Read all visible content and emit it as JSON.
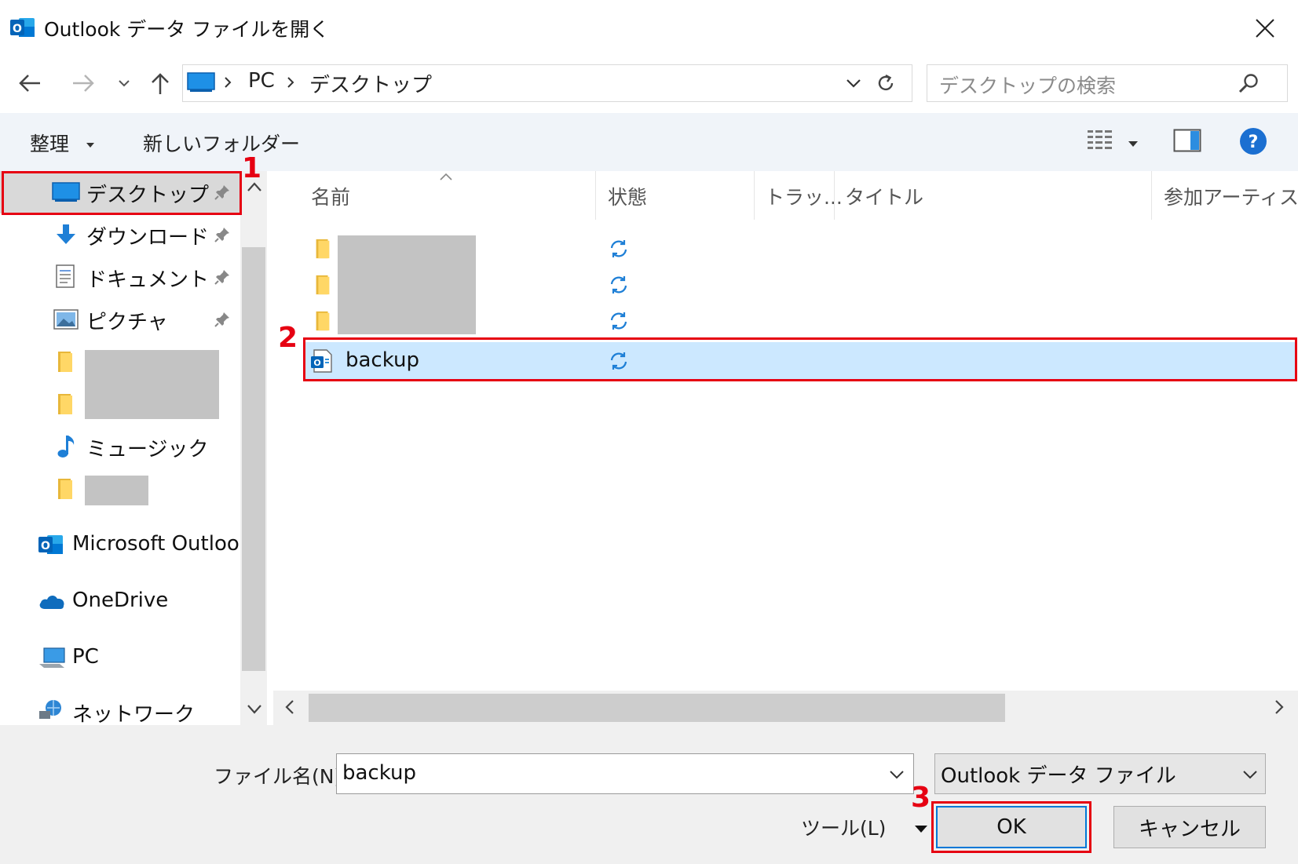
{
  "window": {
    "title": "Outlook データ ファイルを開く"
  },
  "nav": {
    "breadcrumbs": [
      "PC",
      "デスクトップ"
    ],
    "search_placeholder": "デスクトップの検索"
  },
  "toolbar": {
    "organize_label": "整理",
    "new_folder_label": "新しいフォルダー"
  },
  "sidebar": {
    "quick_access": [
      {
        "label": "デスクトップ",
        "icon": "desktop-icon",
        "pinned": true,
        "selected": true
      },
      {
        "label": "ダウンロード",
        "icon": "download-icon",
        "pinned": true
      },
      {
        "label": "ドキュメント",
        "icon": "document-icon",
        "pinned": true
      },
      {
        "label": "ピクチャ",
        "icon": "pictures-icon",
        "pinned": true
      },
      {
        "label": "",
        "icon": "folder-icon",
        "redacted": true
      },
      {
        "label": "",
        "icon": "folder-icon",
        "redacted": true
      },
      {
        "label": "ミュージック",
        "icon": "music-icon"
      },
      {
        "label": "",
        "icon": "folder-icon",
        "redacted": true
      }
    ],
    "locations": [
      {
        "label": "Microsoft Outlook",
        "icon": "outlook-icon"
      },
      {
        "label": "OneDrive",
        "icon": "onedrive-icon"
      },
      {
        "label": "PC",
        "icon": "pc-icon"
      },
      {
        "label": "ネットワーク",
        "icon": "network-icon"
      }
    ]
  },
  "filelist": {
    "columns": [
      "名前",
      "状態",
      "トラッ...",
      "タイトル",
      "参加アーティスト"
    ],
    "rows": [
      {
        "name": "",
        "type": "folder",
        "status_icon": "sync-icon",
        "redacted": true
      },
      {
        "name": "",
        "type": "folder",
        "status_icon": "sync-icon",
        "redacted": true
      },
      {
        "name": "",
        "type": "folder",
        "status_icon": "sync-icon",
        "redacted": true
      },
      {
        "name": "backup",
        "type": "outlook-data-file",
        "status_icon": "sync-icon",
        "selected": true
      }
    ]
  },
  "footer": {
    "filename_label": "ファイル名(N):",
    "filename_value": "backup",
    "filetype_value": "Outlook データ ファイル",
    "tools_label": "ツール(L)",
    "ok_label": "OK",
    "cancel_label": "キャンセル"
  },
  "annotations": [
    "1",
    "2",
    "3"
  ],
  "colors": {
    "selection": "#cce8ff",
    "annotation": "#e60012",
    "accent": "#0078d7"
  }
}
